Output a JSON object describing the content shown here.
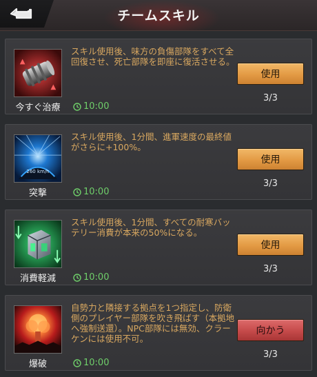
{
  "header": {
    "title": "チームスキル"
  },
  "skills": [
    {
      "name": "今すぐ治療",
      "icon": "repair-canister-icon",
      "description": "スキル使用後、味方の負傷部隊をすべて全回復させ、死亡部隊を即座に復活させる。",
      "timer": "10:00",
      "button": "使用",
      "count": "3/3"
    },
    {
      "name": "突撃",
      "icon": "speedometer-icon",
      "description": "スキル使用後、1分間、進軍速度の最終値がさらに+100%。",
      "timer": "10:00",
      "button": "使用",
      "count": "3/3"
    },
    {
      "name": "消費軽減",
      "icon": "battery-cube-icon",
      "description": "スキル使用後、1分間、すべての耐寒バッテリー消費が本来の50%になる。",
      "timer": "10:00",
      "button": "使用",
      "count": "3/3"
    },
    {
      "name": "爆破",
      "icon": "explosion-icon",
      "description": "自勢力と隣接する拠点を1つ指定し、防衛側のプレイヤー部隊を吹き飛ばす（本拠地へ強制送還）。NPC部隊には無効、クラーケンには使用不可。",
      "timer": "10:00",
      "button": "向かう",
      "count": "3/3"
    }
  ],
  "speedometer_readout": "260 km/h",
  "colors": {
    "description_text": "#d9a860",
    "timer_text": "#6fcf6a",
    "use_button": "#e39a44",
    "go_button": "#c54a4a"
  }
}
